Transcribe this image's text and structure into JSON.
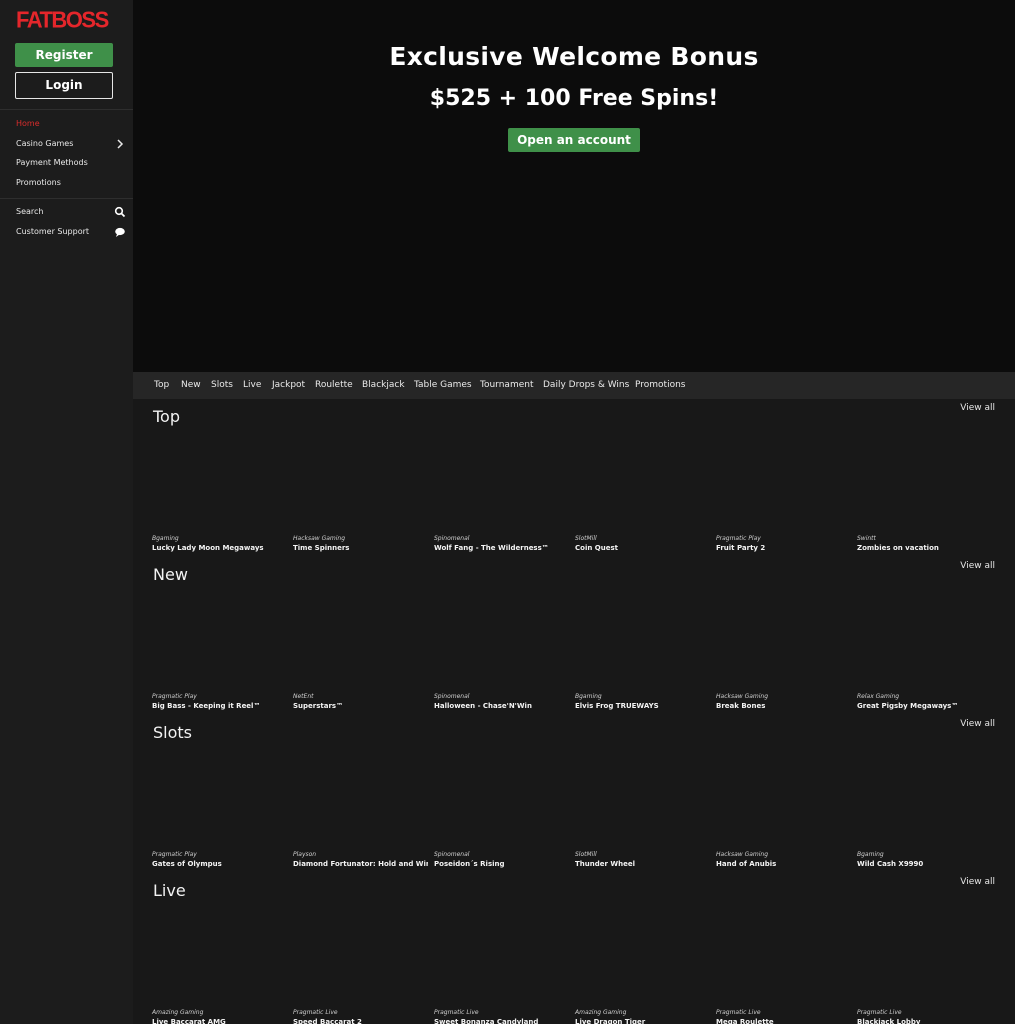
{
  "sidebar": {
    "logo": "FATBOSS",
    "register_label": "Register",
    "login_label": "Login",
    "nav": [
      {
        "label": "Home",
        "active": true
      },
      {
        "label": "Casino Games",
        "icon": "chevron-right-icon"
      },
      {
        "label": "Payment Methods"
      },
      {
        "label": "Promotions"
      }
    ],
    "utility": [
      {
        "label": "Search",
        "icon": "search-icon"
      },
      {
        "label": "Customer Support",
        "icon": "chat-bubble-icon"
      }
    ]
  },
  "hero": {
    "title": "Exclusive Welcome Bonus",
    "subtitle": "$525 + 100 Free Spins!",
    "cta_label": "Open an account"
  },
  "tabs": [
    "Top",
    "New",
    "Slots",
    "Live",
    "Jackpot",
    "Roulette",
    "Blackjack",
    "Table Games",
    "Tournament",
    "Daily Drops & Wins",
    "Promotions"
  ],
  "sections": [
    {
      "title": "Top",
      "view_all": "View all",
      "games": [
        {
          "provider": "Bgaming",
          "name": "Lucky Lady Moon Megaways"
        },
        {
          "provider": "Hacksaw Gaming",
          "name": "Time Spinners"
        },
        {
          "provider": "Spinomenal",
          "name": "Wolf Fang - The Wilderness™"
        },
        {
          "provider": "SlotMill",
          "name": "Coin Quest"
        },
        {
          "provider": "Pragmatic Play",
          "name": "Fruit Party 2"
        },
        {
          "provider": "Swintt",
          "name": "Zombies on vacation"
        }
      ]
    },
    {
      "title": "New",
      "view_all": "View all",
      "games": [
        {
          "provider": "Pragmatic Play",
          "name": "Big Bass - Keeping it Reel™"
        },
        {
          "provider": "NetEnt",
          "name": "Superstars™"
        },
        {
          "provider": "Spinomenal",
          "name": "Halloween - Chase'N'Win"
        },
        {
          "provider": "Bgaming",
          "name": "Elvis Frog TRUEWAYS"
        },
        {
          "provider": "Hacksaw Gaming",
          "name": "Break Bones"
        },
        {
          "provider": "Relax Gaming",
          "name": "Great Pigsby Megaways™"
        }
      ]
    },
    {
      "title": "Slots",
      "view_all": "View all",
      "games": [
        {
          "provider": "Pragmatic Play",
          "name": "Gates of Olympus"
        },
        {
          "provider": "Playson",
          "name": "Diamond Fortunator: Hold and Win"
        },
        {
          "provider": "Spinomenal",
          "name": "Poseidon´s Rising"
        },
        {
          "provider": "SlotMill",
          "name": "Thunder Wheel"
        },
        {
          "provider": "Hacksaw Gaming",
          "name": "Hand of Anubis"
        },
        {
          "provider": "Bgaming",
          "name": "Wild Cash X9990"
        }
      ]
    },
    {
      "title": "Live",
      "view_all": "View all",
      "games": [
        {
          "provider": "Amazing Gaming",
          "name": "Live Baccarat AMG"
        },
        {
          "provider": "Pragmatic Live",
          "name": "Speed Baccarat 2"
        },
        {
          "provider": "Pragmatic Live",
          "name": "Sweet Bonanza Candyland"
        },
        {
          "provider": "Amazing Gaming",
          "name": "Live Dragon Tiger"
        },
        {
          "provider": "Pragmatic Live",
          "name": "Mega Roulette"
        },
        {
          "provider": "Pragmatic Live",
          "name": "Blackjack Lobby"
        }
      ]
    }
  ],
  "colors": {
    "brand_red": "#e4262b",
    "accent_green": "#3f9049",
    "active_nav": "#d92c2c",
    "background": "#181818"
  }
}
